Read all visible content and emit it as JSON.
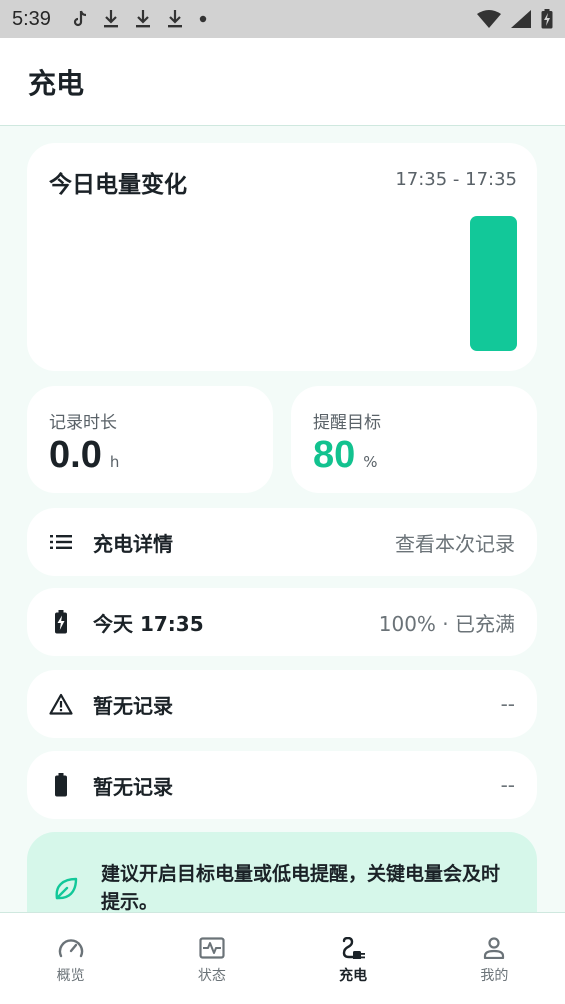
{
  "status_bar": {
    "time": "5:39",
    "notification_icons": [
      "tiktok-icon",
      "download-icon",
      "download-icon",
      "download-icon",
      "dot-icon"
    ],
    "right_icons": [
      "wifi-icon",
      "signal-icon",
      "battery-charging-icon"
    ]
  },
  "app_bar": {
    "title": "充电"
  },
  "chart": {
    "title": "今日电量变化",
    "range": "17:35 - 17:35"
  },
  "chart_data": {
    "type": "bar",
    "categories": [
      "17:35"
    ],
    "values": [
      100
    ],
    "title": "今日电量变化",
    "ylim": [
      0,
      100
    ],
    "colors": [
      "#12c899"
    ]
  },
  "stats": {
    "record_duration": {
      "label": "记录时长",
      "value": "0.0",
      "unit": "h"
    },
    "reminder_target": {
      "label": "提醒目标",
      "value": "80",
      "unit": "%"
    }
  },
  "rows": [
    {
      "icon": "list-icon",
      "title": "充电详情",
      "value": "查看本次记录"
    },
    {
      "icon": "battery-charging-icon",
      "title": "今天 17:35",
      "value": "100% · 已充满"
    },
    {
      "icon": "warning-icon",
      "title": "暂无记录",
      "value": "--"
    },
    {
      "icon": "battery-icon",
      "title": "暂无记录",
      "value": "--"
    }
  ],
  "tip": {
    "icon": "leaf-icon",
    "text": "建议开启目标电量或低电提醒，关键电量会及时提示。"
  },
  "nav": [
    {
      "icon": "gauge-icon",
      "label": "概览",
      "active": false
    },
    {
      "icon": "pulse-icon",
      "label": "状态",
      "active": false
    },
    {
      "icon": "plug-icon",
      "label": "充电",
      "active": true
    },
    {
      "icon": "person-icon",
      "label": "我的",
      "active": false
    }
  ],
  "colors": {
    "accent": "#12c899",
    "background": "#f3fbf8",
    "tip_background": "#d6f7ea"
  }
}
